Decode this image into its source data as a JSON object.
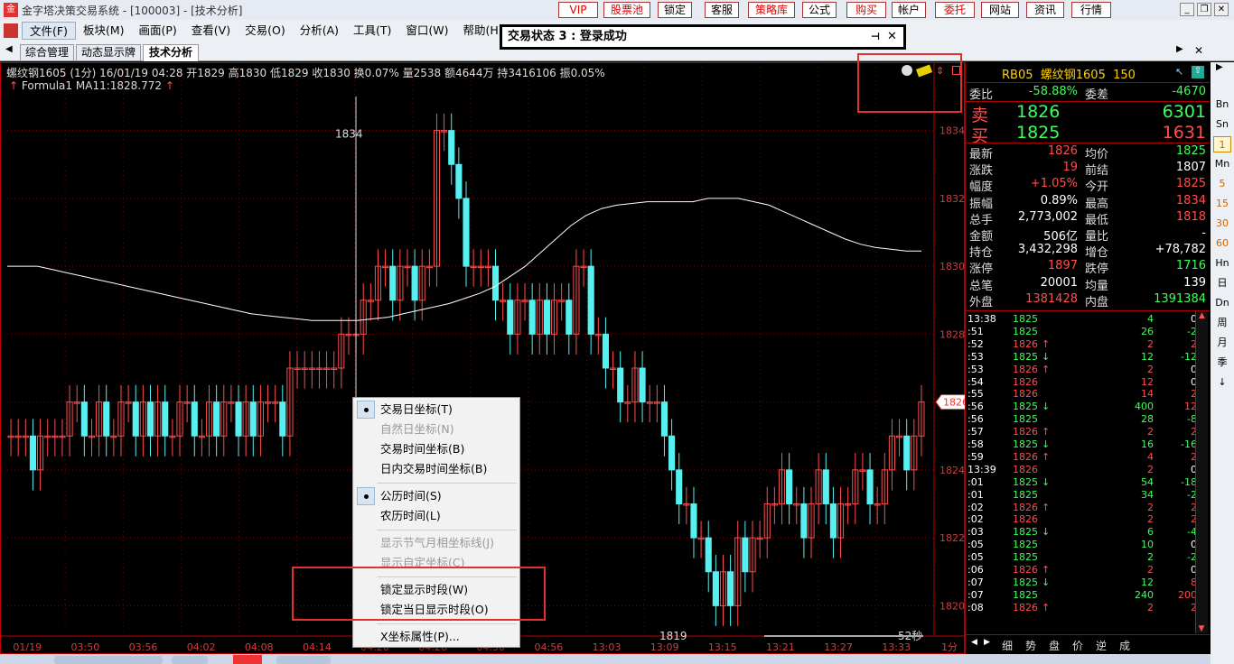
{
  "window": {
    "title": "金字塔决策交易系统 - [100003] - [技术分析]",
    "top_buttons": [
      {
        "label": "VIP",
        "red": true
      },
      {
        "label": "股票池",
        "red": true
      },
      {
        "label": "锁定",
        "red": false
      },
      {
        "label": "客服",
        "red": false
      },
      {
        "label": "策略库",
        "red": true
      },
      {
        "label": "公式",
        "red": false
      },
      {
        "label": "购买",
        "red": true
      },
      {
        "label": "帐户",
        "red": false
      },
      {
        "label": "委托",
        "red": true
      },
      {
        "label": "网站",
        "red": false
      },
      {
        "label": "资讯",
        "red": false
      },
      {
        "label": "行情",
        "red": false
      }
    ]
  },
  "menu": [
    "文件(F)",
    "板块(M)",
    "画面(P)",
    "查看(V)",
    "交易(O)",
    "分析(A)",
    "工具(T)",
    "窗口(W)",
    "帮助(H)"
  ],
  "tabs": [
    "综合管理",
    "动态显示牌",
    "技术分析"
  ],
  "popup": {
    "title": "交易状态 3 : 登录成功"
  },
  "info": {
    "line": "螺纹钢1605 (1分) 16/01/19 04:28 开1829 高1830 低1829 收1830 换0.07% 量2538 额4644万 持3416106 振0.05%",
    "formula_name": "Formula1",
    "formula_value": "MA11:1828.772"
  },
  "chart_data": {
    "type": "candlestick",
    "ylim": [
      1819,
      1835
    ],
    "y_ticks": [
      1820,
      1822,
      1824,
      1826,
      1828,
      1830,
      1832,
      1834
    ],
    "x_ticks": [
      "01/19",
      "03:50",
      "03:56",
      "04:02",
      "04:08",
      "04:14",
      "04:20",
      "04:26",
      "04:50",
      "04:56",
      "13:03",
      "13:09",
      "13:15",
      "13:21",
      "13:27",
      "13:33"
    ],
    "x_unit_label": "1分",
    "annotations": {
      "high_label": "1834",
      "low_label": "1819",
      "timer": "52秒",
      "current_price": "1826"
    },
    "close": [
      1825,
      1825,
      1825,
      1824,
      1825,
      1825,
      1825,
      1825,
      1826,
      1826,
      1825,
      1825,
      1826,
      1825,
      1825,
      1826,
      1826,
      1825,
      1826,
      1825,
      1826,
      1825,
      1825,
      1826,
      1826,
      1825,
      1825,
      1826,
      1825,
      1826,
      1826,
      1825,
      1826,
      1825,
      1826,
      1826,
      1826,
      1825,
      1827,
      1827,
      1827,
      1827,
      1827,
      1827,
      1827,
      1828,
      1828,
      1828,
      1829,
      1829,
      1830,
      1830,
      1829,
      1830,
      1830,
      1829,
      1830,
      1830,
      1834,
      1834,
      1833,
      1832,
      1830,
      1830,
      1830,
      1830,
      1829,
      1829,
      1828,
      1829,
      1829,
      1828,
      1829,
      1828,
      1829,
      1829,
      1828,
      1830,
      1830,
      1828,
      1828,
      1827,
      1827,
      1826,
      1826,
      1827,
      1826,
      1826,
      1826,
      1825,
      1824,
      1823,
      1823,
      1822,
      1822,
      1821,
      1820,
      1821,
      1820,
      1822,
      1821,
      1822,
      1822,
      1823,
      1823,
      1824,
      1823,
      1823,
      1822,
      1823,
      1824,
      1823,
      1822,
      1823,
      1823,
      1824,
      1824,
      1823,
      1823,
      1824,
      1825,
      1825,
      1824,
      1825,
      1826
    ],
    "ma11": [
      1830,
      1830,
      1830,
      1829.9,
      1829.8,
      1829.7,
      1829.6,
      1829.5,
      1829.4,
      1829.3,
      1829.2,
      1829.1,
      1829,
      1828.9,
      1828.8,
      1828.7,
      1828.6,
      1828.55,
      1828.5,
      1828.45,
      1828.4,
      1828.4,
      1828.4,
      1828.4,
      1828.45,
      1828.5,
      1828.6,
      1828.7,
      1828.8,
      1828.9,
      1829.05,
      1829.2,
      1829.4,
      1829.7,
      1830,
      1830.4,
      1830.8,
      1831.2,
      1831.5,
      1831.7,
      1831.8,
      1831.85,
      1831.9,
      1831.9,
      1831.9,
      1831.9,
      1832,
      1832,
      1832,
      1831.9,
      1831.8,
      1831.6,
      1831.4,
      1831.2,
      1831,
      1830.8,
      1830.65,
      1830.55,
      1830.5,
      1830.45,
      1830.45
    ]
  },
  "quote": {
    "symbol": "RB05",
    "name": "螺纹钢1605",
    "contract": "150",
    "weibi_label": "委比",
    "weibi": "-58.88%",
    "weicha_label": "委差",
    "weicha": "-4670",
    "sell_label": "卖",
    "sell_price": "1826",
    "sell_vol": "6301",
    "buy_label": "买",
    "buy_price": "1825",
    "buy_vol": "1631",
    "rows": [
      {
        "l1": "最新",
        "v1": "1826",
        "c1": "red",
        "l2": "均价",
        "v2": "1825",
        "c2": "grn"
      },
      {
        "l1": "涨跌",
        "v1": "19",
        "c1": "red",
        "l2": "前结",
        "v2": "1807",
        "c2": "wht"
      },
      {
        "l1": "幅度",
        "v1": "+1.05%",
        "c1": "red",
        "l2": "今开",
        "v2": "1825",
        "c2": "red"
      },
      {
        "l1": "振幅",
        "v1": "0.89%",
        "c1": "wht",
        "l2": "最高",
        "v2": "1834",
        "c2": "red"
      },
      {
        "l1": "总手",
        "v1": "2,773,002",
        "c1": "wht",
        "l2": "最低",
        "v2": "1818",
        "c2": "red"
      },
      {
        "l1": "金额",
        "v1": "506亿",
        "c1": "wht",
        "l2": "量比",
        "v2": "-",
        "c2": "wht"
      },
      {
        "l1": "持仓",
        "v1": "3,432,298",
        "c1": "wht",
        "l2": "增仓",
        "v2": "+78,782",
        "c2": "wht"
      },
      {
        "l1": "涨停",
        "v1": "1897",
        "c1": "red",
        "l2": "跌停",
        "v2": "1716",
        "c2": "grn"
      },
      {
        "l1": "总笔",
        "v1": "20001",
        "c1": "wht",
        "l2": "均量",
        "v2": "139",
        "c2": "wht"
      },
      {
        "l1": "外盘",
        "v1": "1381428",
        "c1": "red",
        "l2": "内盘",
        "v2": "1391384",
        "c2": "grn"
      }
    ],
    "ticks": [
      {
        "t": "13:38",
        "p": "1825",
        "pc": "grn",
        "a": "",
        "v": "4",
        "vc": "grn",
        "d": "0",
        "dc": "wht"
      },
      {
        "t": ":51",
        "p": "1825",
        "pc": "grn",
        "a": "",
        "v": "26",
        "vc": "grn",
        "d": "-2",
        "dc": "grn"
      },
      {
        "t": ":52",
        "p": "1826",
        "pc": "red",
        "a": "↑",
        "ac": "red",
        "v": "2",
        "vc": "red",
        "d": "2",
        "dc": "red"
      },
      {
        "t": ":53",
        "p": "1825",
        "pc": "grn",
        "a": "↓",
        "ac": "grn",
        "v": "12",
        "vc": "grn",
        "d": "-12",
        "dc": "grn"
      },
      {
        "t": ":53",
        "p": "1826",
        "pc": "red",
        "a": "↑",
        "ac": "red",
        "v": "2",
        "vc": "red",
        "d": "0",
        "dc": "wht"
      },
      {
        "t": ":54",
        "p": "1826",
        "pc": "red",
        "a": "",
        "v": "12",
        "vc": "red",
        "d": "0",
        "dc": "wht"
      },
      {
        "t": ":55",
        "p": "1826",
        "pc": "red",
        "a": "",
        "v": "14",
        "vc": "red",
        "d": "2",
        "dc": "red"
      },
      {
        "t": ":56",
        "p": "1825",
        "pc": "grn",
        "a": "↓",
        "ac": "grn",
        "v": "400",
        "vc": "grn",
        "d": "12",
        "dc": "red"
      },
      {
        "t": ":56",
        "p": "1825",
        "pc": "grn",
        "a": "",
        "v": "28",
        "vc": "grn",
        "d": "-8",
        "dc": "grn"
      },
      {
        "t": ":57",
        "p": "1826",
        "pc": "red",
        "a": "↑",
        "ac": "red",
        "v": "2",
        "vc": "red",
        "d": "2",
        "dc": "red"
      },
      {
        "t": ":58",
        "p": "1825",
        "pc": "grn",
        "a": "↓",
        "ac": "grn",
        "v": "16",
        "vc": "grn",
        "d": "-16",
        "dc": "grn"
      },
      {
        "t": ":59",
        "p": "1826",
        "pc": "red",
        "a": "↑",
        "ac": "red",
        "v": "4",
        "vc": "red",
        "d": "2",
        "dc": "red"
      },
      {
        "t": "13:39",
        "p": "1826",
        "pc": "red",
        "a": "",
        "v": "2",
        "vc": "red",
        "d": "0",
        "dc": "wht"
      },
      {
        "t": ":01",
        "p": "1825",
        "pc": "grn",
        "a": "↓",
        "ac": "grn",
        "v": "54",
        "vc": "grn",
        "d": "-18",
        "dc": "grn"
      },
      {
        "t": ":01",
        "p": "1825",
        "pc": "grn",
        "a": "",
        "v": "34",
        "vc": "grn",
        "d": "-2",
        "dc": "grn"
      },
      {
        "t": ":02",
        "p": "1826",
        "pc": "red",
        "a": "↑",
        "ac": "red",
        "v": "2",
        "vc": "red",
        "d": "2",
        "dc": "red"
      },
      {
        "t": ":02",
        "p": "1826",
        "pc": "red",
        "a": "",
        "v": "2",
        "vc": "red",
        "d": "2",
        "dc": "red"
      },
      {
        "t": ":03",
        "p": "1825",
        "pc": "grn",
        "a": "↓",
        "ac": "grn",
        "v": "6",
        "vc": "grn",
        "d": "-4",
        "dc": "grn"
      },
      {
        "t": ":05",
        "p": "1825",
        "pc": "grn",
        "a": "",
        "v": "10",
        "vc": "grn",
        "d": "0",
        "dc": "wht"
      },
      {
        "t": ":05",
        "p": "1825",
        "pc": "grn",
        "a": "",
        "v": "2",
        "vc": "grn",
        "d": "-2",
        "dc": "grn"
      },
      {
        "t": ":06",
        "p": "1826",
        "pc": "red",
        "a": "↑",
        "ac": "red",
        "v": "2",
        "vc": "red",
        "d": "0",
        "dc": "wht"
      },
      {
        "t": ":07",
        "p": "1825",
        "pc": "grn",
        "a": "↓",
        "ac": "grn",
        "v": "12",
        "vc": "grn",
        "d": "8",
        "dc": "red"
      },
      {
        "t": ":07",
        "p": "1825",
        "pc": "grn",
        "a": "",
        "v": "240",
        "vc": "grn",
        "d": "200",
        "dc": "red"
      },
      {
        "t": ":08",
        "p": "1826",
        "pc": "red",
        "a": "↑",
        "ac": "red",
        "v": "2",
        "vc": "red",
        "d": "2",
        "dc": "red"
      }
    ],
    "bottom_tabs": [
      "细",
      "势",
      "盘",
      "价",
      "逆",
      "成"
    ]
  },
  "side_buttons": [
    "Bn",
    "Sn",
    "1",
    "Mn",
    "5",
    "15",
    "30",
    "60",
    "Hn",
    "日",
    "Dn",
    "周",
    "月",
    "季",
    "↓"
  ],
  "context_menu": [
    {
      "label": "交易日坐标(T)",
      "checked": true,
      "disabled": false
    },
    {
      "label": "自然日坐标(N)",
      "checked": false,
      "disabled": true
    },
    {
      "label": "交易时间坐标(B)",
      "checked": false,
      "disabled": false
    },
    {
      "label": "日内交易时间坐标(B)",
      "checked": false,
      "disabled": false
    },
    {
      "sep": true
    },
    {
      "label": "公历时间(S)",
      "checked": true,
      "disabled": false
    },
    {
      "label": "农历时间(L)",
      "checked": false,
      "disabled": false
    },
    {
      "sep": true
    },
    {
      "label": "显示节气月相坐标线(J)",
      "checked": false,
      "disabled": true
    },
    {
      "label": "显示自定坐标(C)",
      "checked": false,
      "disabled": true
    },
    {
      "sep": true
    },
    {
      "label": "锁定显示时段(W)",
      "checked": false,
      "disabled": false
    },
    {
      "label": "锁定当日显示时段(O)",
      "checked": false,
      "disabled": false
    },
    {
      "sep": true
    },
    {
      "label": "X坐标属性(P)...",
      "checked": false,
      "disabled": false
    }
  ],
  "colors": {
    "up": "#ff4d4d",
    "down": "#56f0f0",
    "ma": "#ffffff",
    "grid": "#7a0000",
    "frame": "#c00000"
  }
}
